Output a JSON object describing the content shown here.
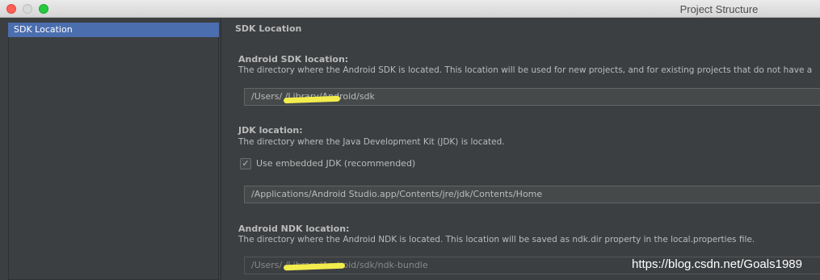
{
  "window": {
    "title": "Project Structure"
  },
  "sidebar": {
    "items": [
      {
        "label": "SDK Location"
      }
    ]
  },
  "main": {
    "section_title": "SDK Location",
    "android_sdk": {
      "label": "Android SDK location:",
      "description": "The directory where the Android SDK is located. This location will be used for new projects, and for existing projects that do not have a",
      "path": "/Users/                     /Library/Android/sdk"
    },
    "jdk": {
      "label": "JDK location:",
      "description": "The directory where the Java Development Kit (JDK) is located.",
      "checkbox_label": "Use embedded JDK (recommended)",
      "checkbox_checked": true,
      "checkbox_glyph": "✓",
      "path": "/Applications/Android Studio.app/Contents/jre/jdk/Contents/Home"
    },
    "ndk": {
      "label": "Android NDK location:",
      "description": "The directory where the Android NDK is located. This location will be saved as ndk.dir property in the local.properties file.",
      "path": "/Users/                     /Library/Android/sdk/ndk-bundle"
    }
  },
  "watermark": "https://blog.csdn.net/Goals1989",
  "colors": {
    "selection": "#4b6eaf",
    "background": "#3c3f41",
    "text": "#bbbbbb",
    "redaction": "#f2ed4c"
  }
}
